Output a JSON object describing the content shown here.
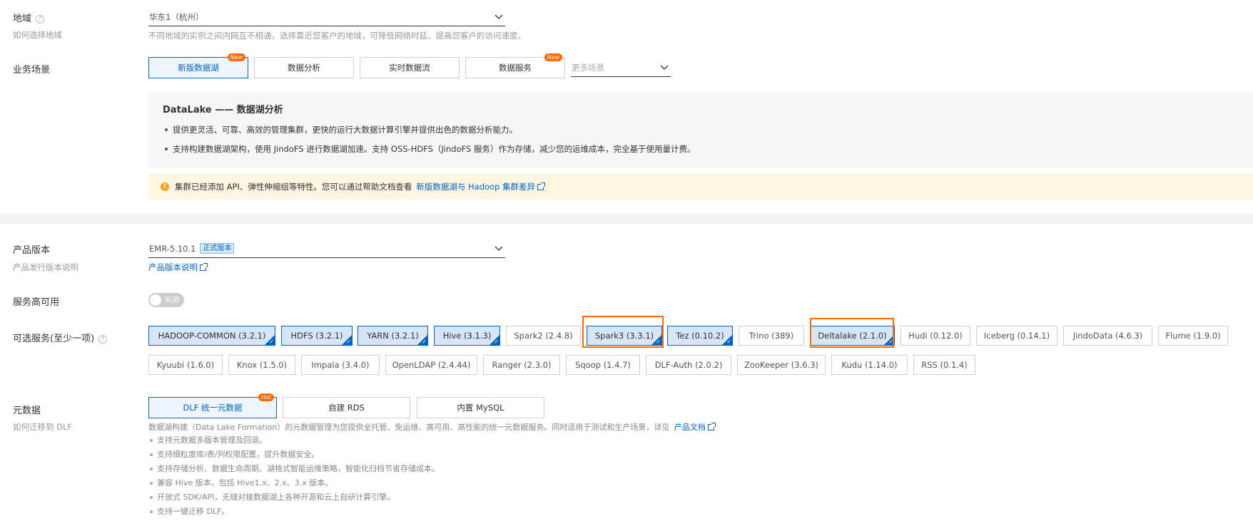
{
  "region": {
    "label": "地域",
    "help_link": "如何选择地域",
    "value": "华东1（杭州）",
    "hint": "不同地域的实例之间内网互不相通，选择靠近您客户的地域，可降低网络时延、提高您客户的访问速度。"
  },
  "scenario": {
    "label": "业务场景",
    "options": [
      {
        "label": "新版数据湖",
        "badge": "New"
      },
      {
        "label": "数据分析",
        "badge": ""
      },
      {
        "label": "实时数据流",
        "badge": ""
      },
      {
        "label": "数据服务",
        "badge": "New"
      }
    ],
    "more_placeholder": "更多场景",
    "panel_title": "DataLake —— 数据湖分析",
    "panel_bullets": [
      "提供更灵活、可靠、高效的管理集群，更快的运行大数据计算引擎并提供出色的数据分析能力。",
      "支持构建数据湖架构，使用 JindoFS 进行数据湖加速。支持 OSS-HDFS（JindoFS 服务）作为存储，减少您的运维成本，完全基于使用量计费。"
    ],
    "warning_text": "集群已经添加 API、弹性伸缩组等特性。您可以通过帮助文档查看",
    "warning_link": "新版数据湖与 Hadoop 集群差异"
  },
  "version": {
    "label": "产品版本",
    "sub": "产品发行版本说明",
    "value": "EMR-5.10.1",
    "tag": "正式版本",
    "link": "产品版本说明"
  },
  "ha": {
    "label": "服务高可用",
    "toggle_text": "关闭",
    "enabled": false
  },
  "services": {
    "label": "可选服务(至少一项)",
    "row1": [
      {
        "label": "HADOOP-COMMON (3.2.1)",
        "selected": true
      },
      {
        "label": "HDFS (3.2.1)",
        "selected": true
      },
      {
        "label": "YARN (3.2.1)",
        "selected": true
      },
      {
        "label": "Hive (3.1.3)",
        "selected": true
      },
      {
        "label": "Spark2 (2.4.8)",
        "selected": false
      },
      {
        "label": "Spark3 (3.3.1)",
        "selected": true
      },
      {
        "label": "Tez (0.10.2)",
        "selected": true
      },
      {
        "label": "Trino (389)",
        "selected": false
      },
      {
        "label": "Deltalake (2.1.0)",
        "selected": true
      },
      {
        "label": "Hudi (0.12.0)",
        "selected": false
      },
      {
        "label": "Iceberg (0.14.1)",
        "selected": false
      },
      {
        "label": "JindoData (4.6.3)",
        "selected": false
      },
      {
        "label": "Flume (1.9.0)",
        "selected": false
      }
    ],
    "row2": [
      {
        "label": "Kyuubi (1.6.0)",
        "selected": false
      },
      {
        "label": "Knox (1.5.0)",
        "selected": false
      },
      {
        "label": "Impala (3.4.0)",
        "selected": false
      },
      {
        "label": "OpenLDAP (2.4.44)",
        "selected": false
      },
      {
        "label": "Ranger (2.3.0)",
        "selected": false
      },
      {
        "label": "Sqoop (1.4.7)",
        "selected": false
      },
      {
        "label": "DLF-Auth (2.0.2)",
        "selected": false
      },
      {
        "label": "ZooKeeper (3.6.3)",
        "selected": false
      },
      {
        "label": "Kudu (1.14.0)",
        "selected": false
      },
      {
        "label": "RSS (0.1.4)",
        "selected": false
      }
    ]
  },
  "metadata": {
    "label": "元数据",
    "sub": "如何迁移到 DLF",
    "options": [
      {
        "label": "DLF 统一元数据",
        "badge": "Hot"
      },
      {
        "label": "自建 RDS",
        "badge": ""
      },
      {
        "label": "内置 MySQL",
        "badge": ""
      }
    ],
    "desc": "数据湖构建（Data Lake Formation）的元数据管理为您提供全托管、免运维、高可用、高性能的统一元数据服务。同时适用于测试和生产场景，详见",
    "desc_link": "产品文档",
    "bullets": [
      "支持元数据多版本管理及回退。",
      "支持细粒度库/表/列权限配置，提升数据安全。",
      "支持存储分析、数据生命周期、湖格式智能运维策略，智能化归档节省存储成本。",
      "兼容 Hive 版本，包括 Hive1.x、2.x、3.x 版本。",
      "开放式 SDK/API，无缝对接数据湖上各种开源和云上自研计算引擎。",
      "支持一键迁移 DLF。"
    ]
  },
  "colors": {
    "accent": "#0064c8",
    "highlight": "#ff6a00",
    "warning_bg": "#fdf6e2"
  }
}
